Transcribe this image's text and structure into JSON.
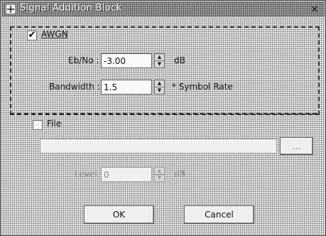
{
  "window": {
    "title": "Signal Addition Block",
    "close_glyph": "×"
  },
  "awgn": {
    "checkbox_label": "AWGN",
    "checked": true,
    "ebno": {
      "label": "Eb/No :",
      "value": "-3.00",
      "unit": "dB"
    },
    "bandwidth": {
      "label": "Bandwidth :",
      "value": "1.5",
      "unit": "* Symbol Rate"
    }
  },
  "file": {
    "checkbox_label": "File",
    "checked": false,
    "path_value": "",
    "browse_label": "...",
    "level": {
      "label": "Level :",
      "value": "0",
      "unit": "dB"
    }
  },
  "buttons": {
    "ok": "OK",
    "cancel": "Cancel"
  },
  "icons": {
    "title": "window-icon",
    "check": "checkmark-icon",
    "spin_up": "arrow-up-icon",
    "spin_down": "arrow-down-icon"
  }
}
